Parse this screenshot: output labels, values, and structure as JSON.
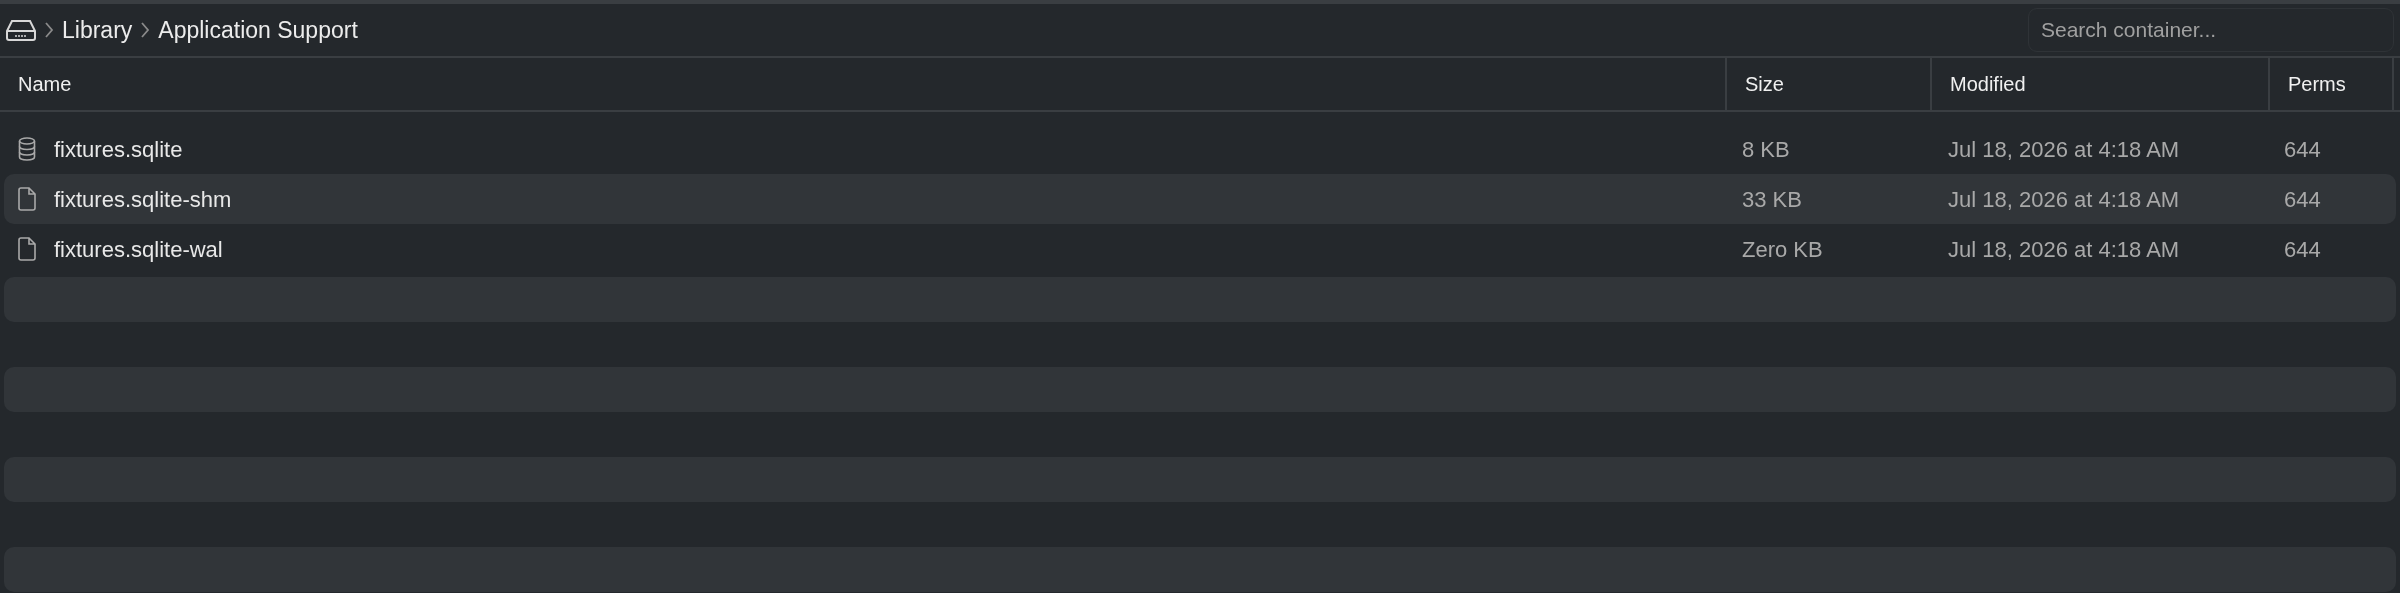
{
  "breadcrumb": {
    "items": [
      "Library",
      "Application Support"
    ]
  },
  "search": {
    "placeholder": "Search container..."
  },
  "table": {
    "columns": [
      "Name",
      "Size",
      "Modified",
      "Perms"
    ],
    "rows": [
      {
        "kind": "database",
        "name": "fixtures.sqlite",
        "size": "8 KB",
        "modified": "Jul 18, 2026 at 4:18 AM",
        "perms": "644"
      },
      {
        "kind": "file",
        "name": "fixtures.sqlite-shm",
        "size": "33 KB",
        "modified": "Jul 18, 2026 at 4:18 AM",
        "perms": "644"
      },
      {
        "kind": "file",
        "name": "fixtures.sqlite-wal",
        "size": "Zero KB",
        "modified": "Jul 18, 2026 at 4:18 AM",
        "perms": "644"
      }
    ]
  }
}
